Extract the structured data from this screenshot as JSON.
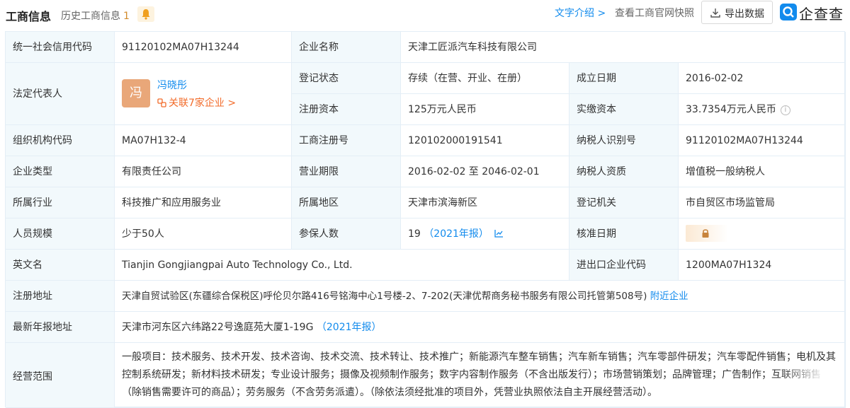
{
  "header": {
    "title": "工商信息",
    "history_label": "历史工商信息",
    "history_count": "1",
    "text_intro_link": "文字介绍 >",
    "official_snapshot_link": "查看工商官网快照",
    "export_button": "导出数据",
    "logo_text": "企查查"
  },
  "labels": {
    "credit_code": "统一社会信用代码",
    "company_name": "企业名称",
    "legal_rep": "法定代表人",
    "reg_status": "登记状态",
    "est_date": "成立日期",
    "reg_capital": "注册资本",
    "paid_capital": "实缴资本",
    "org_code": "组织机构代码",
    "reg_no": "工商注册号",
    "taxpayer_id": "纳税人识别号",
    "company_type": "企业类型",
    "biz_term": "营业期限",
    "taxpayer_qual": "纳税人资质",
    "industry": "所属行业",
    "region": "所属地区",
    "reg_authority": "登记机关",
    "staff_size": "人员规模",
    "insured": "参保人数",
    "approval_date": "核准日期",
    "english_name": "英文名",
    "import_export_code": "进出口企业代码",
    "reg_address": "注册地址",
    "annual_report_address": "最新年报地址",
    "biz_scope": "经营范围"
  },
  "values": {
    "credit_code": "91120102MA07H13244",
    "company_name": "天津工匠派汽车科技有限公司",
    "legal_rep_avatar": "冯",
    "legal_rep_name": "冯晓彤",
    "legal_rep_related": "关联7家企业 >",
    "reg_status": "存续（在营、开业、在册）",
    "est_date": "2016-02-02",
    "reg_capital": "125万元人民币",
    "paid_capital": "33.7354万元人民币",
    "org_code": "MA07H132-4",
    "reg_no": "120102000191541",
    "taxpayer_id": "91120102MA07H13244",
    "company_type": "有限责任公司",
    "biz_term": "2016-02-02 至 2046-02-01",
    "taxpayer_qual": "增值税一般纳税人",
    "industry": "科技推广和应用服务业",
    "region": "天津市滨海新区",
    "reg_authority": "市自贸区市场监管局",
    "staff_size": "少于50人",
    "insured_count": "19",
    "insured_report": "（2021年报）",
    "english_name": "Tianjin Gongjiangpai Auto Technology Co., Ltd.",
    "import_export_code": "1200MA07H1324",
    "reg_address": "天津自贸试验区(东疆综合保税区)呼伦贝尔路416号铭海中心1号楼-2、7-202(天津优帮商务秘书服务有限公司托管第508号)",
    "nearby_link": "附近企业",
    "annual_report_address": "天津市河东区六纬路22号逸庭苑大厦1-19G",
    "annual_report_tag": "（2021年报）",
    "biz_scope": "一般项目：技术服务、技术开发、技术咨询、技术交流、技术转让、技术推广；新能源汽车整车销售；汽车新车销售；汽车零部件研发；汽车零配件销售；电机及其控制系统研发；新材料技术研发；专业设计服务；摄像及视频制作服务；数字内容制作服务（不含出版发行）；市场营销策划；品牌管理；广告制作；互联网销售（除销售需要许可的商品）；劳务服务（不含劳务派遣）。（除依法须经批准的项目外，凭营业执照依法自主开展经营活动）。"
  },
  "colors": {
    "link_blue": "#128bed",
    "label_bg": "#f2f9fc",
    "border": "#e4eef6",
    "accent_orange": "#f26b2a",
    "avatar_bg": "#e9a779"
  }
}
